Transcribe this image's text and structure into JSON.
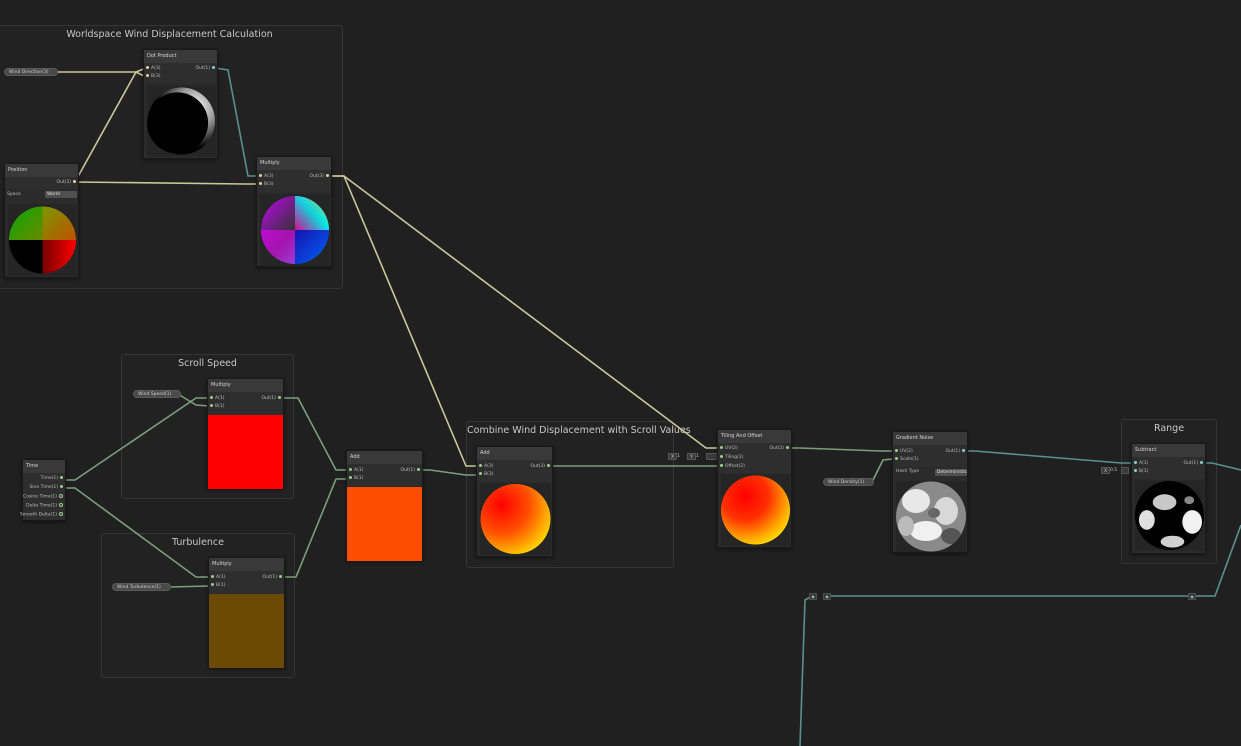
{
  "groups": {
    "wind": "Worldspace Wind Displacement Calculation",
    "scroll": "Scroll Speed",
    "turbulence": "Turbulence",
    "combine": "Combine Wind Displacement with Scroll Values",
    "range": "Range"
  },
  "properties": {
    "wind_direction": "Wind Direction(3)",
    "wind_speed": "Wind Speed(1)",
    "wind_turbulence": "Wind Turbulence(1)",
    "wind_density": "Wind Density(1)"
  },
  "nodes": {
    "dot_product": {
      "title": "Dot Product",
      "in_a": "A(3)",
      "in_b": "B(3)",
      "out": "Out(1)"
    },
    "position": {
      "title": "Position",
      "out": "Out(3)",
      "space_label": "Space",
      "space_value": "World"
    },
    "multiply_wind": {
      "title": "Multiply",
      "in_a": "A(3)",
      "in_b": "B(3)",
      "out": "Out(3)"
    },
    "time": {
      "title": "Time",
      "outs": [
        "Time(1)",
        "Sine Time(1)",
        "Cosine Time(1)",
        "Delta Time(1)",
        "Smooth Delta(1)"
      ]
    },
    "multiply_scroll": {
      "title": "Multiply",
      "in_a": "A(1)",
      "in_b": "B(1)",
      "out": "Out(1)"
    },
    "multiply_turb": {
      "title": "Multiply",
      "in_a": "A(1)",
      "in_b": "B(1)",
      "out": "Out(1)"
    },
    "add_time": {
      "title": "Add",
      "in_a": "A(1)",
      "in_b": "B(1)",
      "out": "Out(1)"
    },
    "add_combine": {
      "title": "Add",
      "in_a": "A(3)",
      "in_b": "B(3)",
      "out": "Out(3)"
    },
    "tiling": {
      "title": "Tiling And Offset",
      "in_uv": "UV(2)",
      "in_tiling": "Tiling(2)",
      "in_offset": "Offset(2)",
      "out": "Out(2)",
      "tiling_x": "X",
      "tiling_x_val": "1",
      "tiling_y": "Y",
      "tiling_y_val": "1"
    },
    "gradient_noise": {
      "title": "Gradient Noise",
      "in_uv": "UV(2)",
      "in_scale": "Scale(1)",
      "out": "Out(1)",
      "hash_label": "Hash Type",
      "hash_value": "Deterministic"
    },
    "subtract": {
      "title": "Subtract",
      "in_a": "A(1)",
      "in_b": "B(1)",
      "out": "Out(1)",
      "const_label": "X",
      "const_value": "0.5"
    }
  },
  "colors": {
    "background": "#202020",
    "edge_vector": "#c8c89a",
    "edge_float": "#7aa07a",
    "edge_teal": "#5a9090",
    "preview_scroll": "#ff0000",
    "preview_add": "#ff4d00",
    "preview_turb": "#6b4a06"
  }
}
